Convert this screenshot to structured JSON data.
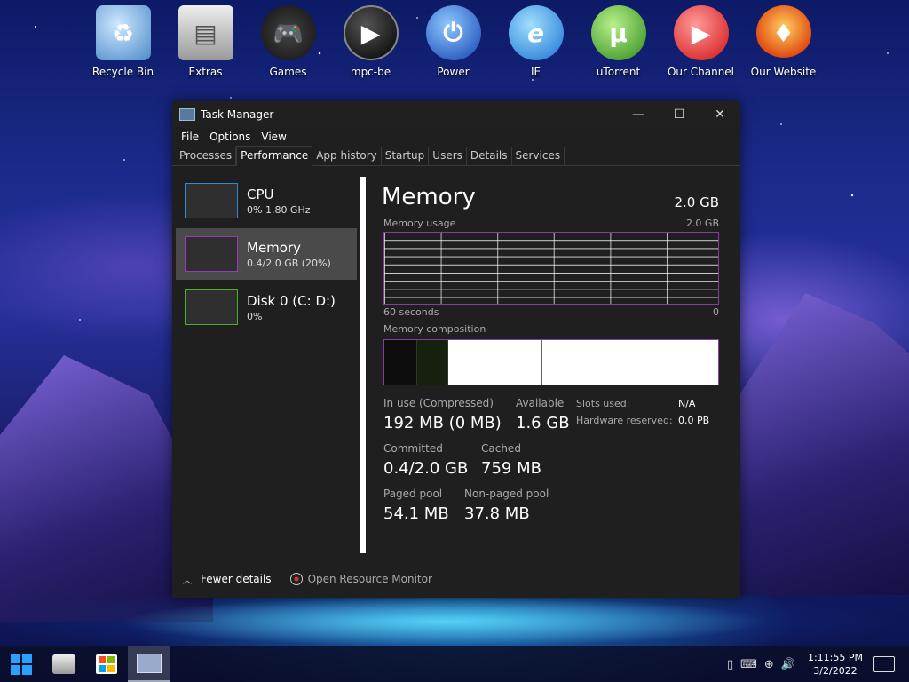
{
  "desktop": {
    "icons": [
      {
        "label": "Recycle Bin",
        "icon": "recycle-bin-icon",
        "color": "#7db7e8"
      },
      {
        "label": "Extras",
        "icon": "folder-icon",
        "color": "#d0d0d0"
      },
      {
        "label": "Games",
        "icon": "gamepad-icon",
        "color": "#222222"
      },
      {
        "label": "mpc-be",
        "icon": "media-player-icon",
        "color": "#111111"
      },
      {
        "label": "Power",
        "icon": "power-icon",
        "color": "#1e6fe0"
      },
      {
        "label": "IE",
        "icon": "internet-explorer-icon",
        "color": "#2a8fe0"
      },
      {
        "label": "uTorrent",
        "icon": "utorrent-icon",
        "color": "#3c9a2a"
      },
      {
        "label": "Our Channel",
        "icon": "youtube-icon",
        "color": "#e02020"
      },
      {
        "label": "Our Website",
        "icon": "phoenix-icon",
        "color": "#e08a20"
      }
    ]
  },
  "window": {
    "title": "Task Manager",
    "controls": {
      "minimize": "—",
      "maximize": "☐",
      "close": "✕"
    },
    "menu": [
      "File",
      "Options",
      "View"
    ],
    "tabs": [
      "Processes",
      "Performance",
      "App history",
      "Startup",
      "Users",
      "Details",
      "Services"
    ],
    "active_tab": "Performance"
  },
  "sidebar": {
    "items": [
      {
        "title": "CPU",
        "sub": "0%  1.80 GHz",
        "color": "#2a8fd0"
      },
      {
        "title": "Memory",
        "sub": "0.4/2.0 GB (20%)",
        "color": "#9a3ab8"
      },
      {
        "title": "Disk 0 (C: D:)",
        "sub": "0%",
        "color": "#4caf2a"
      }
    ]
  },
  "memory": {
    "title": "Memory",
    "total": "2.0 GB",
    "usage_label": "Memory usage",
    "usage_max": "2.0 GB",
    "time_label": "60 seconds",
    "time_end": "0",
    "composition_label": "Memory composition",
    "accent": "#8a3aa8",
    "stats": {
      "in_use_label": "In use (Compressed)",
      "in_use_value": "192 MB (0 MB)",
      "available_label": "Available",
      "available_value": "1.6 GB",
      "committed_label": "Committed",
      "committed_value": "0.4/2.0 GB",
      "cached_label": "Cached",
      "cached_value": "759 MB",
      "paged_label": "Paged pool",
      "paged_value": "54.1 MB",
      "nonpaged_label": "Non-paged pool",
      "nonpaged_value": "37.8 MB",
      "slots_label": "Slots used:",
      "slots_value": "N/A",
      "hw_label": "Hardware reserved:",
      "hw_value": "0.0 PB"
    }
  },
  "footer": {
    "fewer_details": "Fewer details",
    "resource_monitor": "Open Resource Monitor"
  },
  "taskbar": {
    "clock_time": "1:11:55 PM",
    "clock_date": "3/2/2022"
  }
}
